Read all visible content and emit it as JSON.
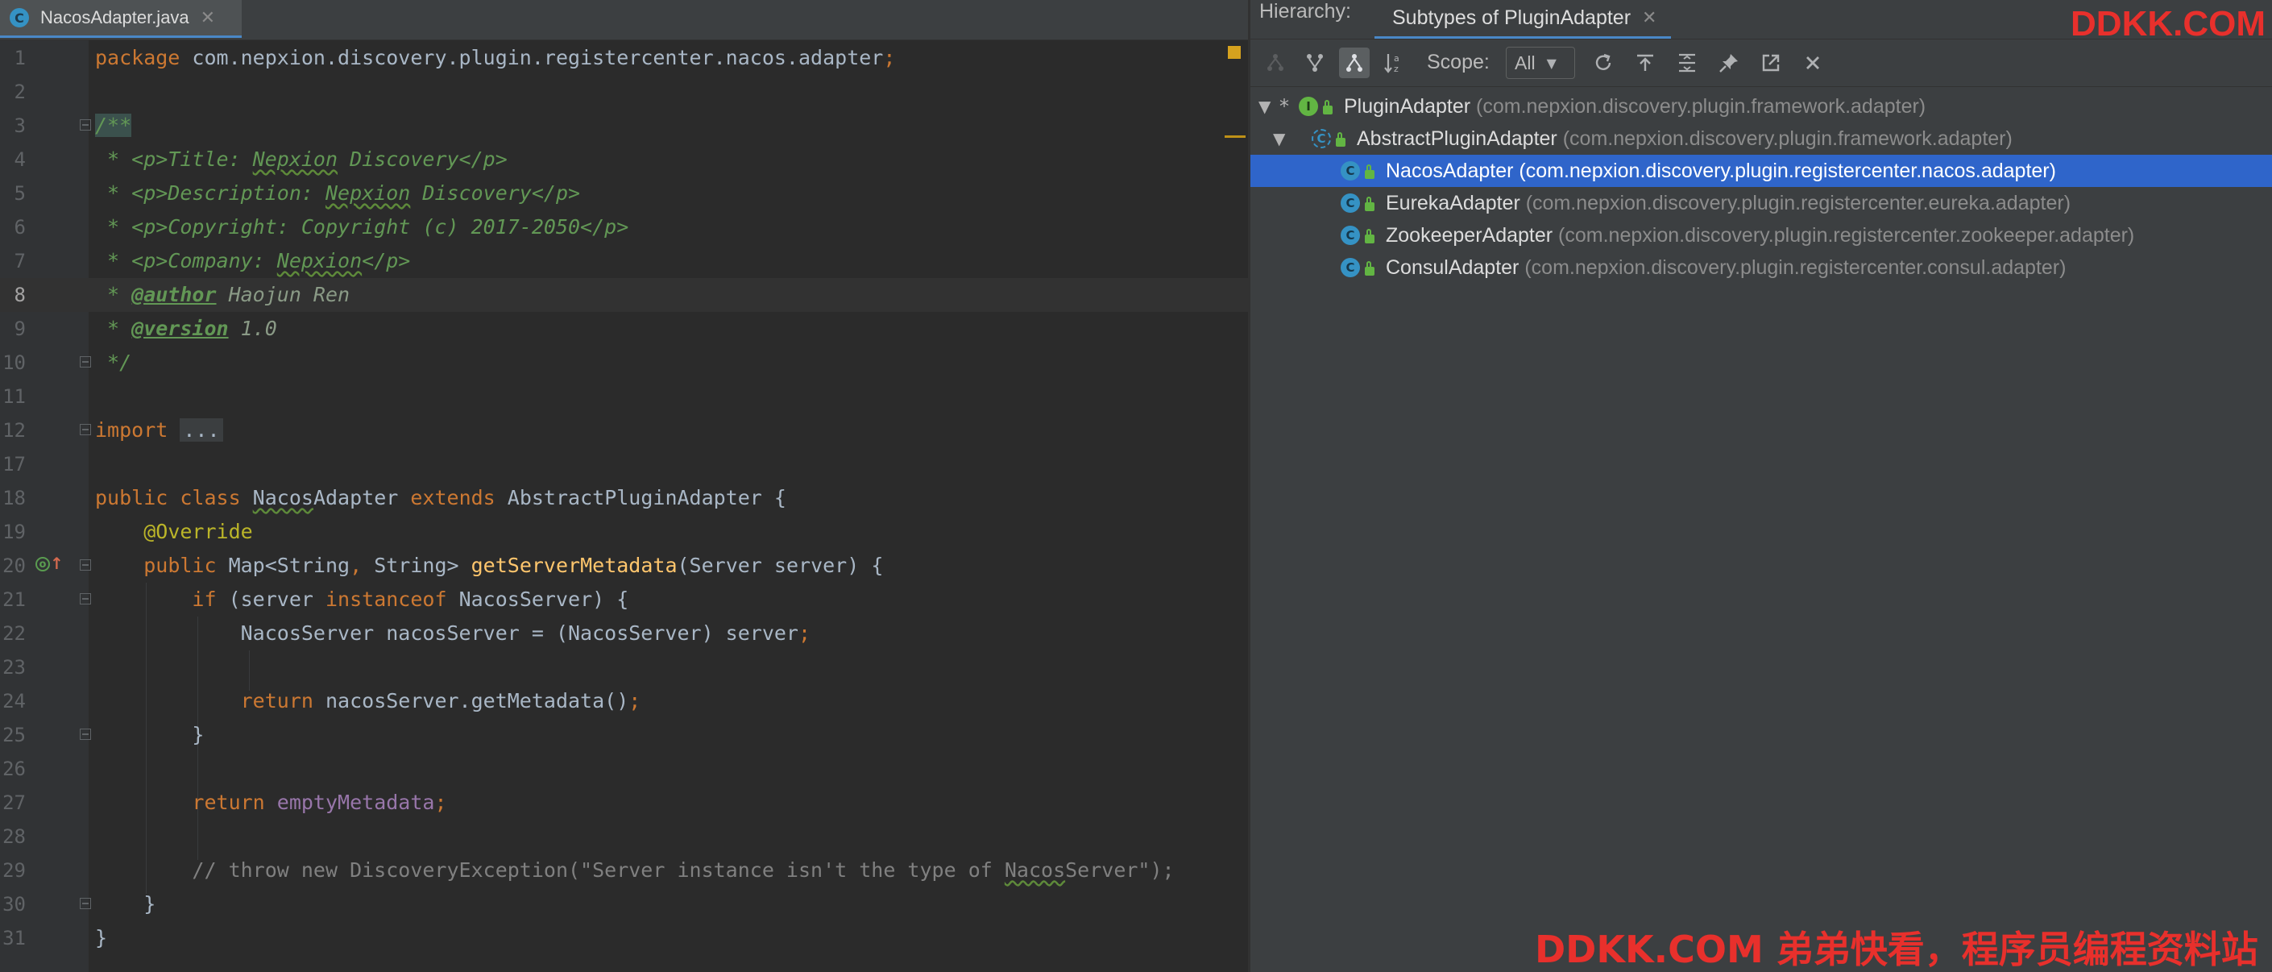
{
  "editor": {
    "tab": {
      "label": "NacosAdapter.java",
      "icon": "java-class-icon",
      "close": "✕"
    },
    "lines": [
      {
        "n": "1",
        "tokens": [
          [
            "kw",
            "package "
          ],
          [
            "",
            "com.nepxion.discovery.plugin.registercenter.nacos.adapter"
          ],
          [
            "kw",
            ";"
          ]
        ]
      },
      {
        "n": "2",
        "tokens": []
      },
      {
        "n": "3",
        "fold": true,
        "tokens": [
          [
            "doc hl-start",
            "/**"
          ]
        ]
      },
      {
        "n": "4",
        "tokens": [
          [
            "doc",
            " * <p>Title: "
          ],
          [
            "doc typo",
            "Nepxion"
          ],
          [
            "doc",
            " Discovery</p>"
          ]
        ]
      },
      {
        "n": "5",
        "tokens": [
          [
            "doc",
            " * <p>Description: "
          ],
          [
            "doc typo",
            "Nepxion"
          ],
          [
            "doc",
            " Discovery</p>"
          ]
        ]
      },
      {
        "n": "6",
        "tokens": [
          [
            "doc",
            " * <p>Copyright: Copyright (c) 2017-2050</p>"
          ]
        ]
      },
      {
        "n": "7",
        "tokens": [
          [
            "doc",
            " * <p>Company: "
          ],
          [
            "doc typo",
            "Nepxion"
          ],
          [
            "doc",
            "</p>"
          ]
        ]
      },
      {
        "n": "8",
        "current": true,
        "tokens": [
          [
            "doc",
            " * "
          ],
          [
            "doctag",
            "@author"
          ],
          [
            "docval",
            " Haojun Ren"
          ]
        ]
      },
      {
        "n": "9",
        "tokens": [
          [
            "doc",
            " * "
          ],
          [
            "doctag",
            "@version"
          ],
          [
            "docval",
            " 1.0"
          ]
        ]
      },
      {
        "n": "10",
        "fold": true,
        "tokens": [
          [
            "doc",
            " */"
          ]
        ]
      },
      {
        "n": "11",
        "tokens": []
      },
      {
        "n": "12",
        "fold": true,
        "tokens": [
          [
            "kw",
            "import "
          ],
          [
            "folded",
            "..."
          ]
        ]
      },
      {
        "n": "17",
        "tokens": []
      },
      {
        "n": "18",
        "tokens": [
          [
            "kw",
            "public class "
          ],
          [
            "typo",
            "Nacos"
          ],
          [
            "",
            "Adapter "
          ],
          [
            "kw",
            "extends "
          ],
          [
            "",
            "AbstractPluginAdapter {"
          ]
        ]
      },
      {
        "n": "19",
        "tokens": [
          [
            "",
            "    "
          ],
          [
            "ann",
            "@Override"
          ]
        ]
      },
      {
        "n": "20",
        "fold": true,
        "override": true,
        "tokens": [
          [
            "",
            "    "
          ],
          [
            "kw",
            "public "
          ],
          [
            "",
            "Map<String"
          ],
          [
            "kw",
            ", "
          ],
          [
            "",
            "String> "
          ],
          [
            "meth",
            "getServerMetadata"
          ],
          [
            "",
            "(Server server) {"
          ]
        ]
      },
      {
        "n": "21",
        "fold": true,
        "tokens": [
          [
            "",
            "        "
          ],
          [
            "kw",
            "if "
          ],
          [
            "",
            "(server "
          ],
          [
            "kw",
            "instanceof "
          ],
          [
            "",
            "NacosServer) {"
          ]
        ]
      },
      {
        "n": "22",
        "tokens": [
          [
            "",
            "            NacosServer nacosServer = (NacosServer) server"
          ],
          [
            "kw",
            ";"
          ]
        ]
      },
      {
        "n": "23",
        "tokens": []
      },
      {
        "n": "24",
        "tokens": [
          [
            "",
            "            "
          ],
          [
            "kw",
            "return "
          ],
          [
            "",
            "nacosServer.getMetadata()"
          ],
          [
            "kw",
            ";"
          ]
        ]
      },
      {
        "n": "25",
        "fold": true,
        "tokens": [
          [
            "",
            "        }"
          ]
        ]
      },
      {
        "n": "26",
        "tokens": []
      },
      {
        "n": "27",
        "tokens": [
          [
            "",
            "        "
          ],
          [
            "kw",
            "return "
          ],
          [
            "fld",
            "emptyMetadata"
          ],
          [
            "kw",
            ";"
          ]
        ]
      },
      {
        "n": "28",
        "tokens": []
      },
      {
        "n": "29",
        "tokens": [
          [
            "cmt",
            "        // throw new DiscoveryException(\"Server instance isn't the type of "
          ],
          [
            "cmt typo",
            "Nacos"
          ],
          [
            "cmt",
            "Server\");"
          ]
        ]
      },
      {
        "n": "30",
        "fold": true,
        "tokens": [
          [
            "",
            "    }"
          ]
        ]
      },
      {
        "n": "31",
        "tokens": [
          [
            "",
            "}"
          ]
        ]
      }
    ]
  },
  "hierarchy": {
    "title": "Hierarchy:",
    "tab": {
      "label": "Subtypes of PluginAdapter",
      "close": "✕"
    },
    "toolbar": {
      "scope_label": "Scope:",
      "scope_value": "All",
      "icons": [
        "supertypes-hierarchy-icon",
        "subtypes-hierarchy-icon",
        "class-hierarchy-icon",
        "sort-alphabetically-icon",
        "refresh-icon",
        "export-icon",
        "expand-all-icon",
        "pin-icon",
        "open-in-window-icon",
        "close-icon"
      ]
    },
    "tree": [
      {
        "name": "PluginAdapter",
        "pkg": "(com.nepxion.discovery.plugin.framework.adapter)",
        "icon": "interface-icon",
        "glyph": "I",
        "depth": 0,
        "expanded": true,
        "star": "*"
      },
      {
        "name": "AbstractPluginAdapter",
        "pkg": "(com.nepxion.discovery.plugin.framework.adapter)",
        "icon": "abstract-class-icon",
        "glyph": "C",
        "depth": 1,
        "expanded": true
      },
      {
        "name": "NacosAdapter",
        "pkg": "(com.nepxion.discovery.plugin.registercenter.nacos.adapter)",
        "icon": "class-icon",
        "glyph": "C",
        "depth": 2,
        "selected": true
      },
      {
        "name": "EurekaAdapter",
        "pkg": "(com.nepxion.discovery.plugin.registercenter.eureka.adapter)",
        "icon": "class-icon",
        "glyph": "C",
        "depth": 2
      },
      {
        "name": "ZookeeperAdapter",
        "pkg": "(com.nepxion.discovery.plugin.registercenter.zookeeper.adapter)",
        "icon": "class-icon",
        "glyph": "C",
        "depth": 2
      },
      {
        "name": "ConsulAdapter",
        "pkg": "(com.nepxion.discovery.plugin.registercenter.consul.adapter)",
        "icon": "class-icon",
        "glyph": "C",
        "depth": 2
      }
    ]
  },
  "watermarks": {
    "top": "DDKK.COM",
    "bottom": "DDKK.COM 弟弟快看，程序员编程资料站"
  },
  "colors": {
    "accent": "#4a88c7",
    "selection": "#2f65ca",
    "watermark": "#e8302c",
    "keyword": "#cc7832",
    "doc_comment": "#629755"
  }
}
